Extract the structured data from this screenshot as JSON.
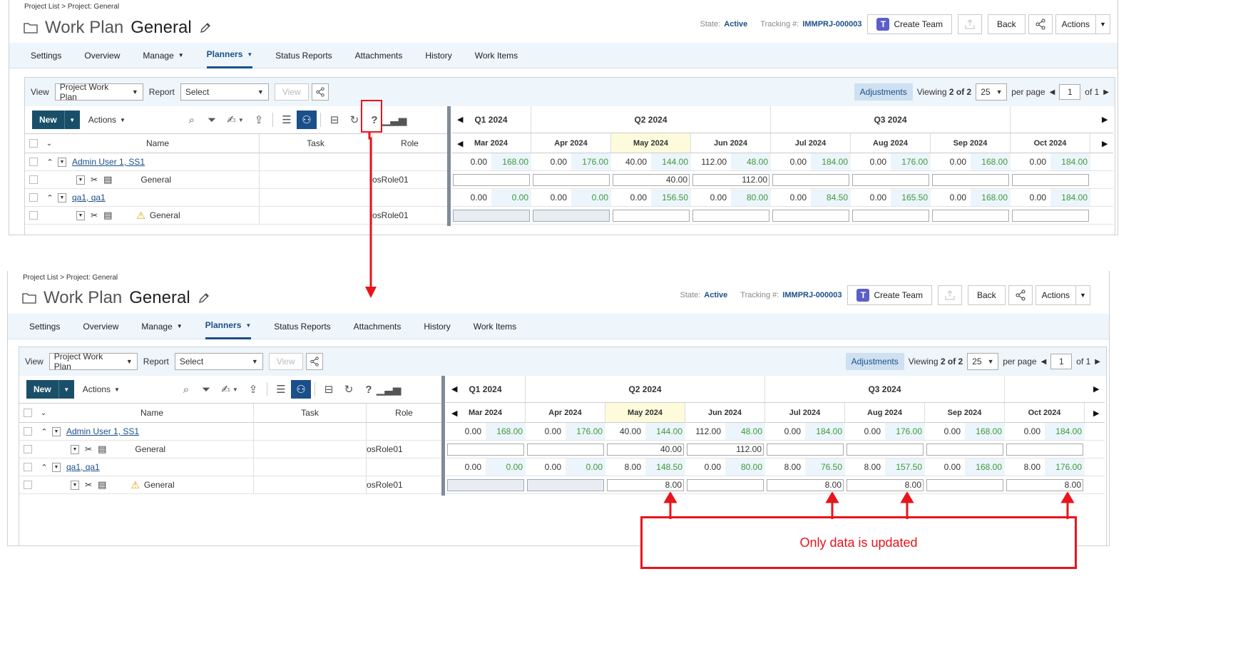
{
  "breadcrumb": "Project List > Project: General",
  "title": {
    "prefix": "Work Plan",
    "name": "General"
  },
  "state": {
    "label": "State:",
    "value": "Active"
  },
  "tracking": {
    "label": "Tracking #:",
    "value": "IMMPRJ-000003"
  },
  "buttons": {
    "create_team": "Create Team",
    "back": "Back",
    "actions": "Actions"
  },
  "nav": [
    "Settings",
    "Overview",
    "Manage",
    "Planners",
    "Status Reports",
    "Attachments",
    "History",
    "Work Items"
  ],
  "viewbar": {
    "view_label": "View",
    "view_value": "Project Work Plan",
    "report_label": "Report",
    "report_value": "Select",
    "view_btn": "View",
    "adjustments": "Adjustments",
    "viewing_prefix": "Viewing",
    "viewing_bold": "2 of 2",
    "per_page_value": "25",
    "per_page_label": "per page",
    "page_value": "1",
    "page_of": "of 1"
  },
  "toolbar": {
    "new": "New",
    "actions": "Actions"
  },
  "columns": {
    "name": "Name",
    "task": "Task",
    "role": "Role"
  },
  "quarters": [
    "Q1 2024",
    "Q2 2024",
    "Q3 2024"
  ],
  "months": [
    "Mar 2024",
    "Apr 2024",
    "May 2024",
    "Jun 2024",
    "Jul 2024",
    "Aug 2024",
    "Sep 2024",
    "Oct 2024"
  ],
  "before": {
    "rows": [
      {
        "name": "Admin User 1, SS1",
        "role": "",
        "vals": [
          [
            "0.00",
            "168.00"
          ],
          [
            "0.00",
            "176.00"
          ],
          [
            "40.00",
            "144.00"
          ],
          [
            "112.00",
            "48.00"
          ],
          [
            "0.00",
            "184.00"
          ],
          [
            "0.00",
            "176.00"
          ],
          [
            "0.00",
            "168.00"
          ],
          [
            "0.00",
            "184.00"
          ]
        ]
      },
      {
        "name": "General",
        "role": "osRole01",
        "inputs": [
          "",
          "",
          "40.00",
          "112.00",
          "",
          "",
          "",
          ""
        ]
      },
      {
        "name": "qa1, qa1",
        "role": "",
        "vals": [
          [
            "0.00",
            "0.00"
          ],
          [
            "0.00",
            "0.00"
          ],
          [
            "0.00",
            "156.50"
          ],
          [
            "0.00",
            "80.00"
          ],
          [
            "0.00",
            "84.50"
          ],
          [
            "0.00",
            "165.50"
          ],
          [
            "0.00",
            "168.00"
          ],
          [
            "0.00",
            "184.00"
          ]
        ]
      },
      {
        "name": "General",
        "role": "osRole01",
        "inputs": [
          "",
          "",
          "",
          "",
          "",
          "",
          "",
          ""
        ]
      }
    ]
  },
  "after": {
    "rows": [
      {
        "name": "Admin User 1, SS1",
        "role": "",
        "vals": [
          [
            "0.00",
            "168.00"
          ],
          [
            "0.00",
            "176.00"
          ],
          [
            "40.00",
            "144.00"
          ],
          [
            "112.00",
            "48.00"
          ],
          [
            "0.00",
            "184.00"
          ],
          [
            "0.00",
            "176.00"
          ],
          [
            "0.00",
            "168.00"
          ],
          [
            "0.00",
            "184.00"
          ]
        ]
      },
      {
        "name": "General",
        "role": "osRole01",
        "inputs": [
          "",
          "",
          "40.00",
          "112.00",
          "",
          "",
          "",
          ""
        ]
      },
      {
        "name": "qa1, qa1",
        "role": "",
        "vals": [
          [
            "0.00",
            "0.00"
          ],
          [
            "0.00",
            "0.00"
          ],
          [
            "8.00",
            "148.50"
          ],
          [
            "0.00",
            "80.00"
          ],
          [
            "8.00",
            "76.50"
          ],
          [
            "8.00",
            "157.50"
          ],
          [
            "0.00",
            "168.00"
          ],
          [
            "8.00",
            "176.00"
          ]
        ]
      },
      {
        "name": "General",
        "role": "osRole01",
        "inputs": [
          "",
          "",
          "8.00",
          "",
          "8.00",
          "8.00",
          "",
          "8.00"
        ]
      }
    ]
  },
  "callout": "Only data is updated",
  "colors": {
    "accent": "#1a4f8a",
    "annotation": "#e8141c",
    "green": "#3a9a3a"
  }
}
